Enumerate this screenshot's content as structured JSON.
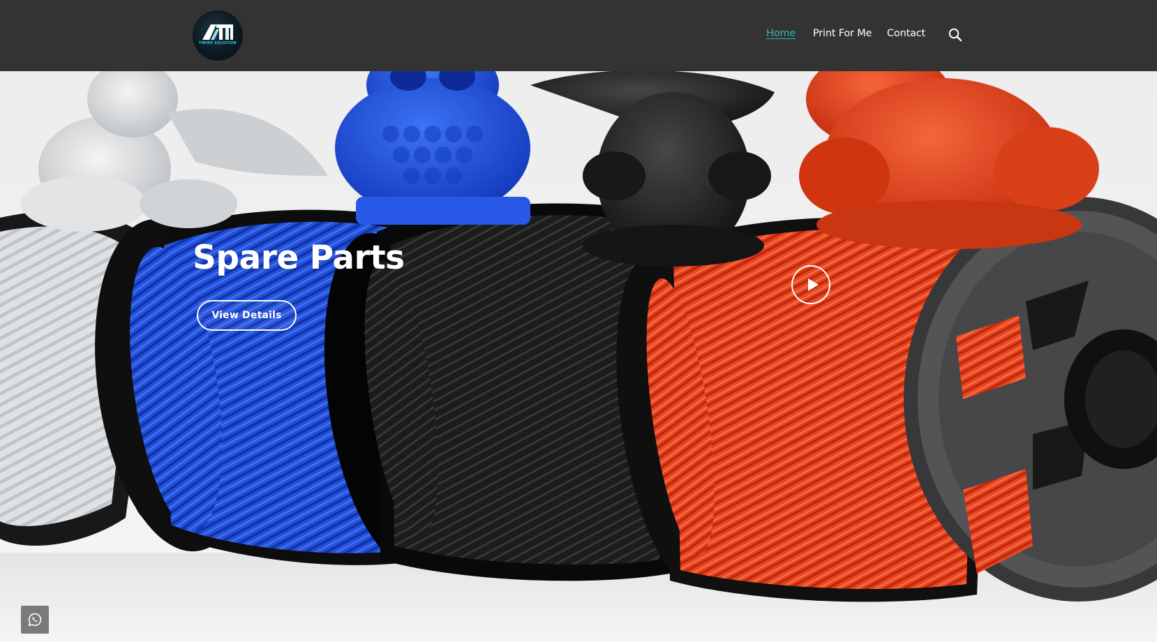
{
  "header": {
    "logo_text": "TWIRE SOLUTION",
    "nav": [
      {
        "label": "Home",
        "active": true
      },
      {
        "label": "Print For Me",
        "active": false
      },
      {
        "label": "Contact",
        "active": false
      }
    ],
    "search_icon": "search-icon",
    "colors": {
      "background": "#333333",
      "active_link": "#2fb7a4",
      "link": "#ffffff"
    }
  },
  "hero": {
    "title": "Spare Parts",
    "button_label": "View Details",
    "play_icon": "play-icon",
    "image_icon_names": [
      "white-dragon-figure",
      "blue-owl-figure",
      "black-dragon-figure",
      "red-gorilla-figure",
      "filament-spools"
    ],
    "colors": {
      "white_spool": "#e8eaec",
      "blue_spool": "#1f4fe0",
      "black_spool": "#1b1b1b",
      "red_spool": "#f0401a",
      "reel": "#4a4a4c"
    }
  },
  "floating": {
    "whatsapp_icon": "whatsapp-icon",
    "background": "#7a7a7a"
  }
}
